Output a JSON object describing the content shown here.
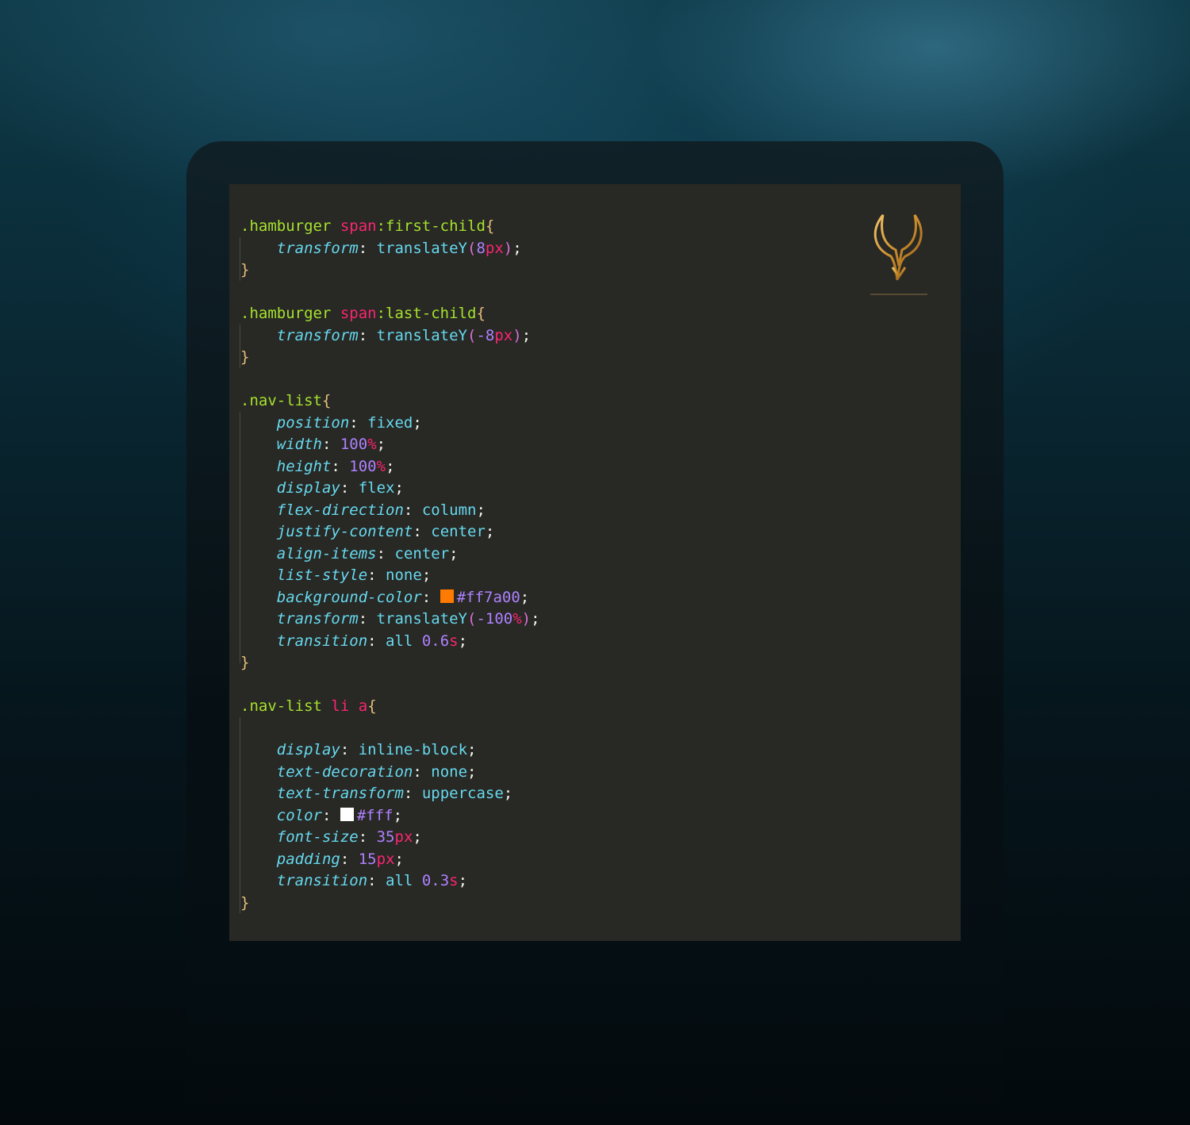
{
  "colors": {
    "swatch_orange": "#ff7a00",
    "swatch_white": "#fff"
  },
  "logo": {
    "icon": "bull-horns-logo-icon"
  },
  "code": {
    "b1": {
      "selector": ".hamburger",
      "tag": "span",
      "pseudo": ":first-child",
      "open": "{",
      "prop": "transform",
      "colon": ":",
      "func": "translateY",
      "lp": "(",
      "num": "8",
      "unit": "px",
      "rp": ")",
      "semi": ";",
      "close": "}"
    },
    "b2": {
      "selector": ".hamburger",
      "tag": "span",
      "pseudo": ":last-child",
      "open": "{",
      "prop": "transform",
      "colon": ":",
      "func": "translateY",
      "lp": "(",
      "num": "-8",
      "unit": "px",
      "rp": ")",
      "semi": ";",
      "close": "}"
    },
    "b3": {
      "selector": ".nav-list",
      "open": "{",
      "close": "}",
      "l1": {
        "prop": "position",
        "val": "fixed"
      },
      "l2": {
        "prop": "width",
        "num": "100",
        "unit": "%"
      },
      "l3": {
        "prop": "height",
        "num": "100",
        "unit": "%"
      },
      "l4": {
        "prop": "display",
        "val": "flex"
      },
      "l5": {
        "prop": "flex-direction",
        "val": "column"
      },
      "l6": {
        "prop": "justify-content",
        "val": "center"
      },
      "l7": {
        "prop": "align-items",
        "val": "center"
      },
      "l8": {
        "prop": "list-style",
        "val": "none"
      },
      "l9": {
        "prop": "background-color",
        "val": "#ff7a00"
      },
      "l10": {
        "prop": "transform",
        "func": "translateY",
        "lp": "(",
        "num": "-100",
        "unit": "%",
        "rp": ")"
      },
      "l11": {
        "prop": "transition",
        "val": "all",
        "num": "0.6",
        "unit": "s"
      }
    },
    "b4": {
      "selector": ".nav-list",
      "tag1": "li",
      "tag2": "a",
      "open": "{",
      "close": "}",
      "l1": {
        "prop": "display",
        "val": "inline-block"
      },
      "l2": {
        "prop": "text-decoration",
        "val": "none"
      },
      "l3": {
        "prop": "text-transform",
        "val": "uppercase"
      },
      "l4": {
        "prop": "color",
        "val": "#fff"
      },
      "l5": {
        "prop": "font-size",
        "num": "35",
        "unit": "px"
      },
      "l6": {
        "prop": "padding",
        "num": "15",
        "unit": "px"
      },
      "l7": {
        "prop": "transition",
        "val": "all",
        "num": "0.3",
        "unit": "s"
      }
    }
  }
}
